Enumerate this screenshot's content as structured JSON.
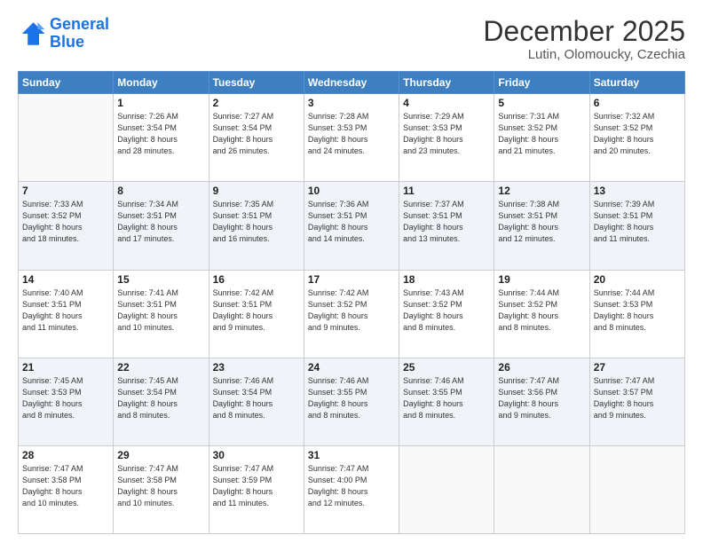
{
  "logo": {
    "line1": "General",
    "line2": "Blue"
  },
  "title": "December 2025",
  "subtitle": "Lutin, Olomoucky, Czechia",
  "days_of_week": [
    "Sunday",
    "Monday",
    "Tuesday",
    "Wednesday",
    "Thursday",
    "Friday",
    "Saturday"
  ],
  "weeks": [
    [
      {
        "day": "",
        "content": ""
      },
      {
        "day": "1",
        "content": "Sunrise: 7:26 AM\nSunset: 3:54 PM\nDaylight: 8 hours\nand 28 minutes."
      },
      {
        "day": "2",
        "content": "Sunrise: 7:27 AM\nSunset: 3:54 PM\nDaylight: 8 hours\nand 26 minutes."
      },
      {
        "day": "3",
        "content": "Sunrise: 7:28 AM\nSunset: 3:53 PM\nDaylight: 8 hours\nand 24 minutes."
      },
      {
        "day": "4",
        "content": "Sunrise: 7:29 AM\nSunset: 3:53 PM\nDaylight: 8 hours\nand 23 minutes."
      },
      {
        "day": "5",
        "content": "Sunrise: 7:31 AM\nSunset: 3:52 PM\nDaylight: 8 hours\nand 21 minutes."
      },
      {
        "day": "6",
        "content": "Sunrise: 7:32 AM\nSunset: 3:52 PM\nDaylight: 8 hours\nand 20 minutes."
      }
    ],
    [
      {
        "day": "7",
        "content": "Sunrise: 7:33 AM\nSunset: 3:52 PM\nDaylight: 8 hours\nand 18 minutes."
      },
      {
        "day": "8",
        "content": "Sunrise: 7:34 AM\nSunset: 3:51 PM\nDaylight: 8 hours\nand 17 minutes."
      },
      {
        "day": "9",
        "content": "Sunrise: 7:35 AM\nSunset: 3:51 PM\nDaylight: 8 hours\nand 16 minutes."
      },
      {
        "day": "10",
        "content": "Sunrise: 7:36 AM\nSunset: 3:51 PM\nDaylight: 8 hours\nand 14 minutes."
      },
      {
        "day": "11",
        "content": "Sunrise: 7:37 AM\nSunset: 3:51 PM\nDaylight: 8 hours\nand 13 minutes."
      },
      {
        "day": "12",
        "content": "Sunrise: 7:38 AM\nSunset: 3:51 PM\nDaylight: 8 hours\nand 12 minutes."
      },
      {
        "day": "13",
        "content": "Sunrise: 7:39 AM\nSunset: 3:51 PM\nDaylight: 8 hours\nand 11 minutes."
      }
    ],
    [
      {
        "day": "14",
        "content": "Sunrise: 7:40 AM\nSunset: 3:51 PM\nDaylight: 8 hours\nand 11 minutes."
      },
      {
        "day": "15",
        "content": "Sunrise: 7:41 AM\nSunset: 3:51 PM\nDaylight: 8 hours\nand 10 minutes."
      },
      {
        "day": "16",
        "content": "Sunrise: 7:42 AM\nSunset: 3:51 PM\nDaylight: 8 hours\nand 9 minutes."
      },
      {
        "day": "17",
        "content": "Sunrise: 7:42 AM\nSunset: 3:52 PM\nDaylight: 8 hours\nand 9 minutes."
      },
      {
        "day": "18",
        "content": "Sunrise: 7:43 AM\nSunset: 3:52 PM\nDaylight: 8 hours\nand 8 minutes."
      },
      {
        "day": "19",
        "content": "Sunrise: 7:44 AM\nSunset: 3:52 PM\nDaylight: 8 hours\nand 8 minutes."
      },
      {
        "day": "20",
        "content": "Sunrise: 7:44 AM\nSunset: 3:53 PM\nDaylight: 8 hours\nand 8 minutes."
      }
    ],
    [
      {
        "day": "21",
        "content": "Sunrise: 7:45 AM\nSunset: 3:53 PM\nDaylight: 8 hours\nand 8 minutes."
      },
      {
        "day": "22",
        "content": "Sunrise: 7:45 AM\nSunset: 3:54 PM\nDaylight: 8 hours\nand 8 minutes."
      },
      {
        "day": "23",
        "content": "Sunrise: 7:46 AM\nSunset: 3:54 PM\nDaylight: 8 hours\nand 8 minutes."
      },
      {
        "day": "24",
        "content": "Sunrise: 7:46 AM\nSunset: 3:55 PM\nDaylight: 8 hours\nand 8 minutes."
      },
      {
        "day": "25",
        "content": "Sunrise: 7:46 AM\nSunset: 3:55 PM\nDaylight: 8 hours\nand 8 minutes."
      },
      {
        "day": "26",
        "content": "Sunrise: 7:47 AM\nSunset: 3:56 PM\nDaylight: 8 hours\nand 9 minutes."
      },
      {
        "day": "27",
        "content": "Sunrise: 7:47 AM\nSunset: 3:57 PM\nDaylight: 8 hours\nand 9 minutes."
      }
    ],
    [
      {
        "day": "28",
        "content": "Sunrise: 7:47 AM\nSunset: 3:58 PM\nDaylight: 8 hours\nand 10 minutes."
      },
      {
        "day": "29",
        "content": "Sunrise: 7:47 AM\nSunset: 3:58 PM\nDaylight: 8 hours\nand 10 minutes."
      },
      {
        "day": "30",
        "content": "Sunrise: 7:47 AM\nSunset: 3:59 PM\nDaylight: 8 hours\nand 11 minutes."
      },
      {
        "day": "31",
        "content": "Sunrise: 7:47 AM\nSunset: 4:00 PM\nDaylight: 8 hours\nand 12 minutes."
      },
      {
        "day": "",
        "content": ""
      },
      {
        "day": "",
        "content": ""
      },
      {
        "day": "",
        "content": ""
      }
    ]
  ]
}
